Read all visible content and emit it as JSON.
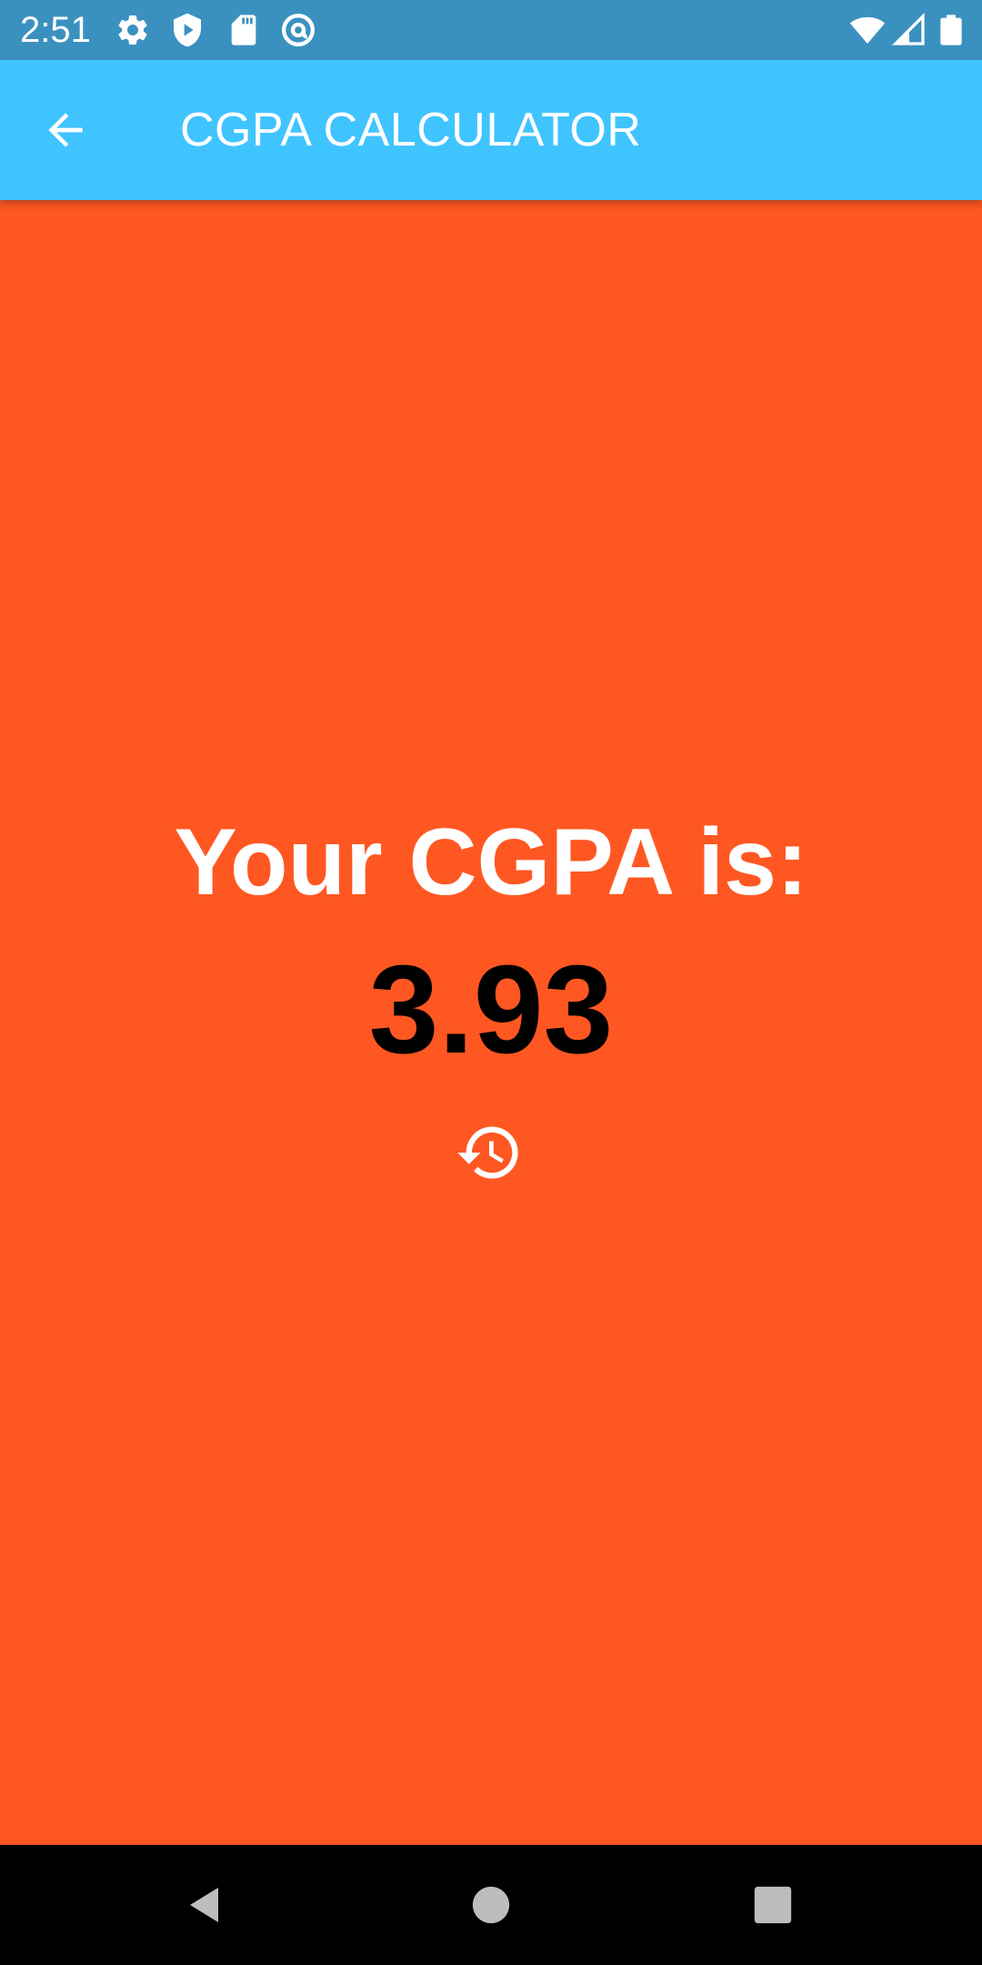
{
  "status_bar": {
    "time": "2:51",
    "left_icons": [
      "gear-icon",
      "shield-play-icon",
      "sd-card-icon",
      "at-sign-icon"
    ],
    "right_icons": [
      "wifi-icon",
      "cell-signal-icon",
      "battery-icon"
    ]
  },
  "app_bar": {
    "title": "CGPA CALCULATOR",
    "back_icon": "arrow-back-icon"
  },
  "result": {
    "label": "Your CGPA is:",
    "value": "3.93",
    "history_icon": "history-icon"
  },
  "nav_bar": {
    "buttons": [
      "back-triangle-icon",
      "home-circle-icon",
      "recents-square-icon"
    ]
  },
  "colors": {
    "status_bar": "#3a91bf",
    "app_bar": "#40c4ff",
    "background": "#ff5722",
    "label_text": "#ffffff",
    "value_text": "#000000",
    "nav_bar": "#000000"
  }
}
